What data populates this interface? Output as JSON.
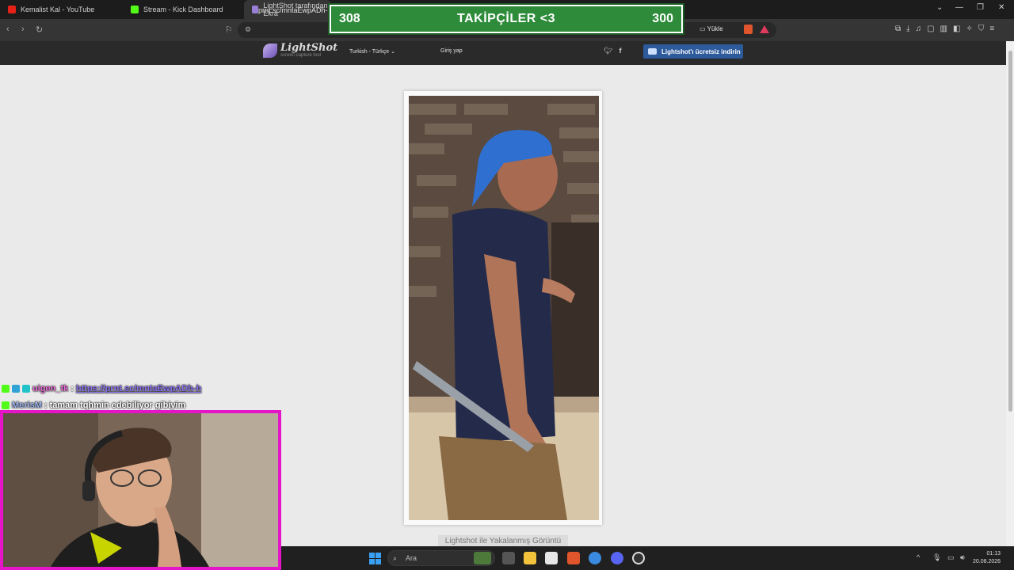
{
  "tabs": [
    {
      "label": "Kemalist Kal - YouTube",
      "icon": "youtube-icon"
    },
    {
      "label": "Stream - Kick Dashboard",
      "icon": "kick-icon"
    },
    {
      "label": "LightShot tarafından Ekra",
      "icon": "lightshot-icon"
    }
  ],
  "address": {
    "url": "prnt.sc/mntaEwpADh-h"
  },
  "toolbar": {
    "upload_label": "Yükle"
  },
  "follower_goal": {
    "current": "308",
    "title": "TAKİPÇİLER <3",
    "target": "300"
  },
  "lightshot": {
    "logo_name": "LightShot",
    "logo_tagline": "screen capture tool",
    "language": "Turkish - Türkçe",
    "login": "Giriş yap",
    "download_label": "Lightshot'ı ücretsiz indirin",
    "caption": "Lightshot ile Yakalanmış Görüntü"
  },
  "chat": [
    {
      "user": "uigen_tk",
      "separator": ":",
      "message": "https://prnt.sc/mntaEwpADh-h"
    },
    {
      "user": "MerisM",
      "separator": ":",
      "message": "tamam tqhmin edebiliyor gibiyim"
    }
  ],
  "taskbar": {
    "search_placeholder": "Ara",
    "time": "01:13",
    "date": "20.08.2026"
  },
  "colors": {
    "follow_bg": "#2e8b3a",
    "webcam_border": "#e414c8",
    "download_btn": "#2d5a9b"
  }
}
